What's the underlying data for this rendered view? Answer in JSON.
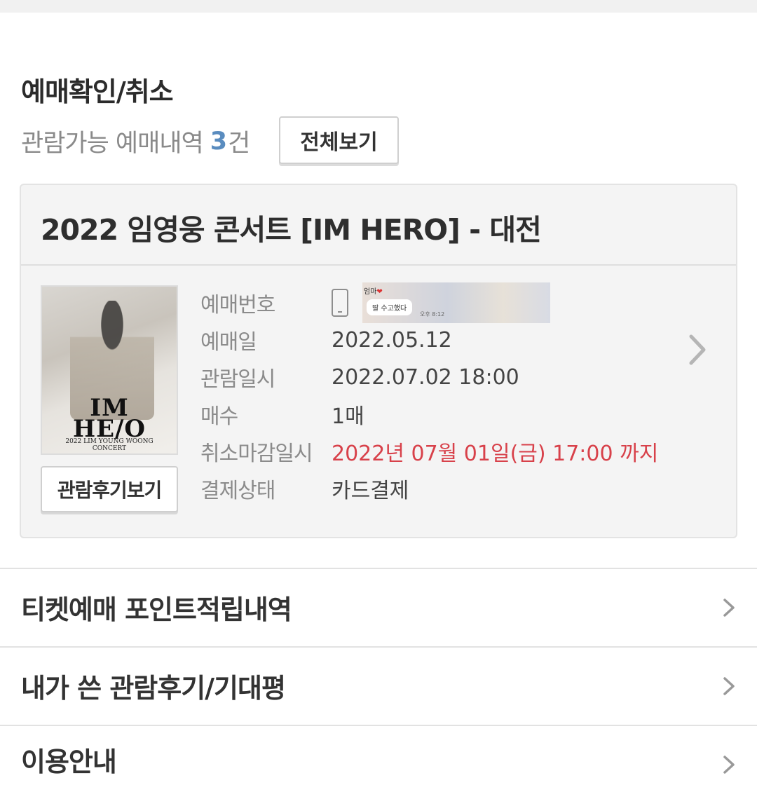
{
  "section": {
    "title": "예매확인/취소",
    "summary_prefix": "관람가능 예매내역",
    "summary_count": "3",
    "summary_unit": "건",
    "view_all_label": "전체보기"
  },
  "booking": {
    "title": "2022 임영웅 콘서트 [IM HERO] - 대전",
    "poster": {
      "logo_line1": "IM",
      "logo_line2": "HE/O",
      "subtitle_line1": "2022 LIM YOUNG WOONG",
      "subtitle_line2": "CONCERT"
    },
    "review_button_label": "관람후기보기",
    "booking_number_image": {
      "name_text": "엄마",
      "bubble_text": "딸 수고했다",
      "time_text": "오후 8:12"
    },
    "rows": [
      {
        "label": "예매번호",
        "value": ""
      },
      {
        "label": "예매일",
        "value": "2022.05.12"
      },
      {
        "label": "관람일시",
        "value": "2022.07.02 18:00"
      },
      {
        "label": "매수",
        "value": "1매"
      },
      {
        "label": "취소마감일시",
        "value": "2022년 07월 01일(금) 17:00 까지"
      },
      {
        "label": "결제상태",
        "value": "카드결제"
      }
    ]
  },
  "menu": [
    {
      "label": "티켓예매 포인트적립내역"
    },
    {
      "label": "내가 쓴 관람후기/기대평"
    },
    {
      "label": "이용안내"
    }
  ],
  "colors": {
    "accent_count": "#5a8cbf",
    "deadline_red": "#d8414a"
  }
}
